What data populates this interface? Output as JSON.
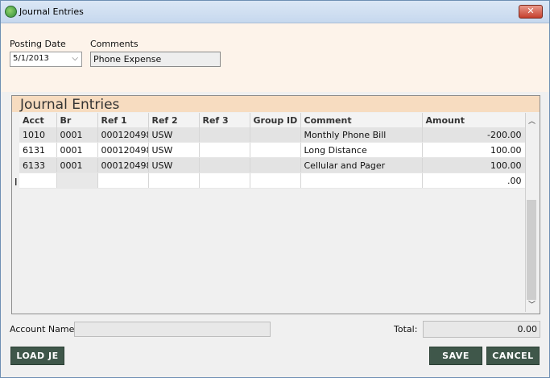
{
  "window": {
    "title": "Journal Entries",
    "close_glyph": "✕",
    "app_icon": "app-globe-icon"
  },
  "form": {
    "posting_date_label": "Posting Date",
    "posting_date_value": "5/1/2013",
    "comments_label": "Comments",
    "comments_value": "Phone Expense"
  },
  "journal": {
    "section_title": "Journal Entries",
    "columns": [
      "Acct",
      "Br",
      "Ref 1",
      "Ref 2",
      "Ref 3",
      "Group ID",
      "Comment",
      "Amount"
    ],
    "rows": [
      {
        "acct": "1010",
        "br": "0001",
        "ref1": "000120498",
        "ref2": "USW",
        "ref3": "",
        "group_id": "",
        "comment": "Monthly Phone Bill",
        "amount": "-200.00"
      },
      {
        "acct": "6131",
        "br": "0001",
        "ref1": "000120498",
        "ref2": "USW",
        "ref3": "",
        "group_id": "",
        "comment": "Long Distance",
        "amount": "100.00"
      },
      {
        "acct": "6133",
        "br": "0001",
        "ref1": "000120498",
        "ref2": "USW",
        "ref3": "",
        "group_id": "",
        "comment": "Cellular and Pager",
        "amount": "100.00"
      }
    ],
    "new_row_amount": ".00"
  },
  "footer": {
    "account_name_label": "Account Name:",
    "account_name_value": "",
    "total_label": "Total:",
    "total_value": "0.00",
    "load_je_label": "LOAD JE",
    "save_label": "SAVE",
    "cancel_label": "CANCEL"
  }
}
